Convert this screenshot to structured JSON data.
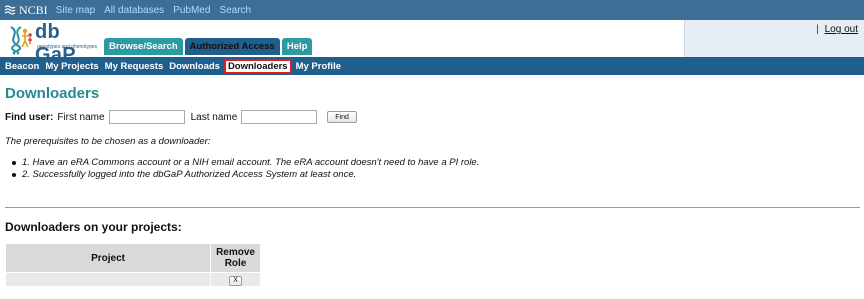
{
  "ncbi_bar": {
    "logo_text": "NCBI",
    "links": [
      "Site map",
      "All databases",
      "PubMed",
      "Search"
    ]
  },
  "header": {
    "logout_separator": "|",
    "logout": "Log out",
    "logo_title": "db GaP",
    "logo_subtitle": "genotypes and phenotypes",
    "tabs": [
      {
        "label": "Browse/Search"
      },
      {
        "label": "Authorized Access"
      },
      {
        "label": "Help"
      }
    ]
  },
  "subnav": {
    "items": [
      {
        "label": "Beacon"
      },
      {
        "label": "My Projects"
      },
      {
        "label": "My Requests"
      },
      {
        "label": "Downloads"
      },
      {
        "label": "Downloaders"
      },
      {
        "label": "My Profile"
      }
    ],
    "active": "Downloaders"
  },
  "main": {
    "title": "Downloaders",
    "find_user": {
      "label": "Find user:",
      "first_name_label": "First name",
      "first_name_value": "",
      "last_name_label": "Last name",
      "last_name_value": "",
      "button": "Find"
    },
    "prereq_intro": "The prerequisites to be chosen as a downloader:",
    "prereqs": [
      "1. Have an eRA Commons account or a NIH email account. The eRA account doesn't need to have a PI role.",
      "2. Successfully logged into the dbGaP Authorized Access System at least once."
    ],
    "projects_section_title": "Downloaders on your projects:",
    "table": {
      "headers": [
        "Project",
        "Remove Role"
      ],
      "header_remove_line1": "Remove",
      "header_remove_line2": "Role",
      "rows": [
        {
          "project": "",
          "remove": "X"
        }
      ]
    }
  },
  "colors": {
    "ncbi_bar": "#3d6e96",
    "nav_blue": "#1f5f8e",
    "teal": "#2c9aa2",
    "title_teal": "#268a93",
    "highlight_red": "#e01b24"
  }
}
